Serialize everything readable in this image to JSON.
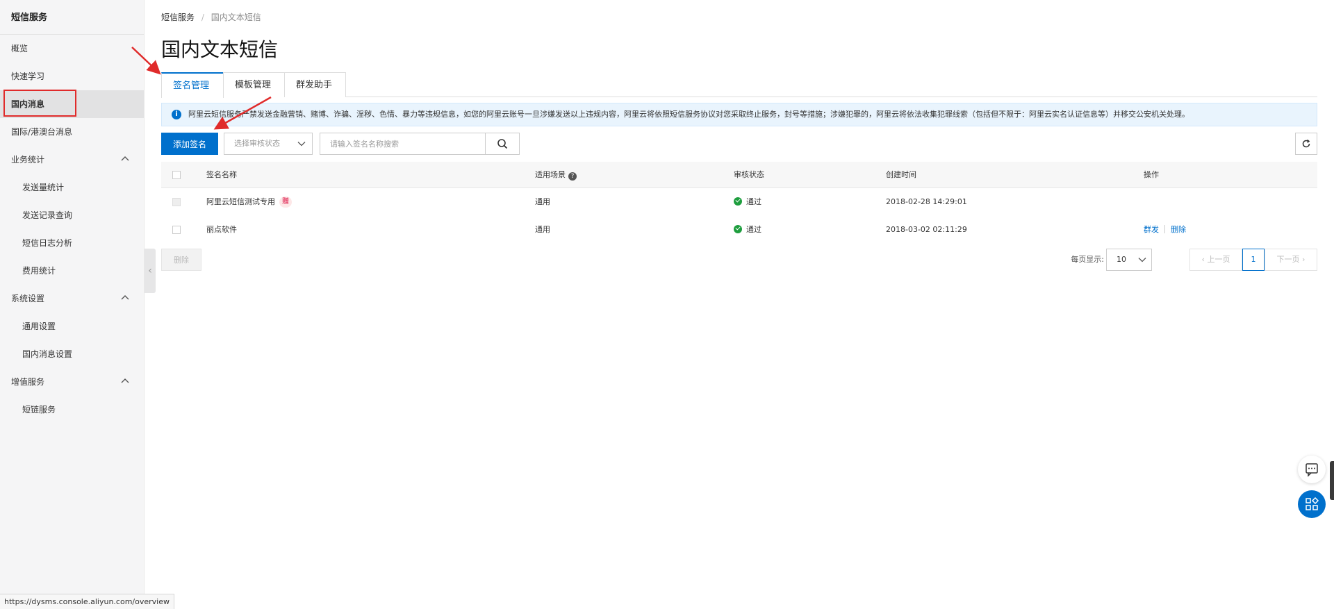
{
  "sidebar": {
    "title": "短信服务",
    "items": [
      {
        "label": "概览"
      },
      {
        "label": "快速学习"
      },
      {
        "label": "国内消息"
      },
      {
        "label": "国际/港澳台消息"
      },
      {
        "label": "业务统计"
      },
      {
        "label": "发送量统计"
      },
      {
        "label": "发送记录查询"
      },
      {
        "label": "短信日志分析"
      },
      {
        "label": "费用统计"
      },
      {
        "label": "系统设置"
      },
      {
        "label": "通用设置"
      },
      {
        "label": "国内消息设置"
      },
      {
        "label": "增值服务"
      },
      {
        "label": "短链服务"
      }
    ]
  },
  "breadcrumb": {
    "root": "短信服务",
    "separator": "/",
    "current": "国内文本短信"
  },
  "page_title": "国内文本短信",
  "tabs": [
    {
      "label": "签名管理"
    },
    {
      "label": "模板管理"
    },
    {
      "label": "群发助手"
    }
  ],
  "notice": {
    "icon": "info-icon",
    "text": "阿里云短信服务严禁发送金融营销、赌博、诈骗、淫秽、色情、暴力等违规信息，如您的阿里云账号一旦涉嫌发送以上违规内容，阿里云将依照短信服务协议对您采取终止服务，封号等措施；涉嫌犯罪的，阿里云将依法收集犯罪线索（包括但不限于：阿里云实名认证信息等）并移交公安机关处理。"
  },
  "toolbar": {
    "add_label": "添加签名",
    "status_select_placeholder": "选择审核状态",
    "search_placeholder": "请输入签名名称搜索"
  },
  "table": {
    "headers": {
      "name": "签名名称",
      "scene": "适用场景",
      "status": "审核状态",
      "created": "创建时间",
      "ops": "操作"
    },
    "rows": [
      {
        "name": "阿里云短信测试专用",
        "tag": "赠",
        "scene": "通用",
        "status": "通过",
        "created": "2018-02-28 14:29:01"
      },
      {
        "name": "丽点软件",
        "scene": "通用",
        "status": "通过",
        "created": "2018-03-02 02:11:29",
        "op1": "群发",
        "op2": "删除"
      }
    ]
  },
  "footer": {
    "delete_label": "删除",
    "per_page_label": "每页显示:",
    "per_page_value": "10",
    "prev_label": "上一页",
    "current_page": "1",
    "next_label": "下一页"
  },
  "status_url": "https://dysms.console.aliyun.com/overview",
  "colors": {
    "primary": "#0070cc",
    "highlight": "#e02b2b",
    "success": "#1e9e3e"
  }
}
